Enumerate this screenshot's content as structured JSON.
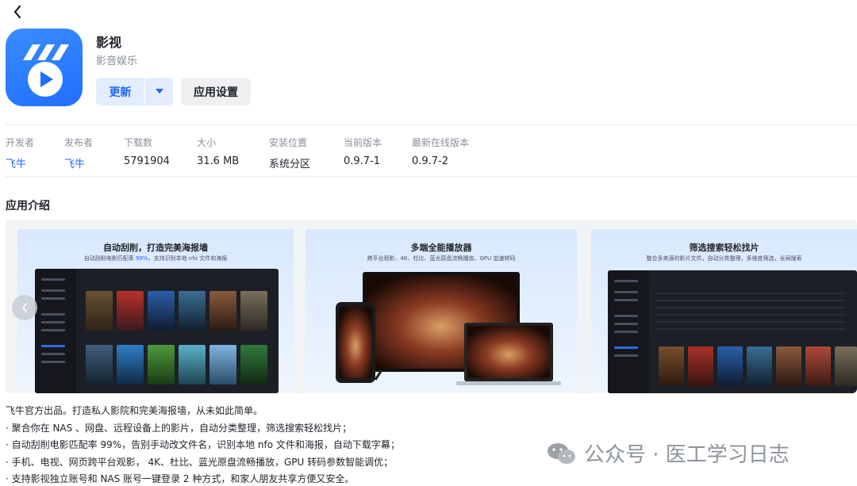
{
  "header": {
    "back_icon": "chevron-left-icon"
  },
  "app": {
    "name": "影视",
    "category": "影音娱乐",
    "icon": "feiniu-video-logo-icon",
    "brand_color": "#1a66ff"
  },
  "actions": {
    "update_label": "更新",
    "settings_label": "应用设置"
  },
  "info": [
    {
      "label": "开发者",
      "value": "飞牛",
      "link": true
    },
    {
      "label": "发布者",
      "value": "飞牛",
      "link": true
    },
    {
      "label": "下载数",
      "value": "5791904",
      "link": false
    },
    {
      "label": "大小",
      "value": "31.6 MB",
      "link": false
    },
    {
      "label": "安装位置",
      "value": "系统分区",
      "link": false
    },
    {
      "label": "当前版本",
      "value": "0.9.7-1",
      "link": false
    },
    {
      "label": "最新在线版本",
      "value": "0.9.7-2",
      "link": false
    }
  ],
  "intro": {
    "title": "应用介绍",
    "slides": [
      {
        "title": "自动刮削，打造完美海报墙",
        "sub_pre": "自动刮削电影匹配率 ",
        "sub_hl": "99%",
        "sub_post": "，支持识别本地 nfo 文件和海报"
      },
      {
        "title": "多端全能播放器",
        "sub_pre": "跨平台观影、4K、杜比、蓝光原盘流畅播放、GPU 加速转码",
        "sub_hl": "",
        "sub_post": ""
      },
      {
        "title": "筛选搜索轻松找片",
        "sub_pre": "整合多来源的影片文件，自动分类整理，多维度筛选，全局搜索",
        "sub_hl": "",
        "sub_post": ""
      }
    ],
    "description": [
      "飞牛官方出品。打造私人影院和完美海报墙，从未如此简单。",
      "· 聚合你在 NAS 、网盘、远程设备上的影片，自动分类整理，筛选搜索轻松找片；",
      "· 自动刮削电影匹配率 99%，告别手动改文件名，识别本地 nfo 文件和海报，自动下载字幕；",
      "· 手机、电视、网页跨平台观影， 4K、杜比、蓝光原盘流畅播放，GPU 转码参数智能调优；",
      "· 支持影视独立账号和 NAS 账号一键登录 2 种方式，和家人朋友共享方便又安全。"
    ]
  },
  "watermark": {
    "text": "公众号 · 医工学习日志",
    "icon": "wechat-icon"
  }
}
